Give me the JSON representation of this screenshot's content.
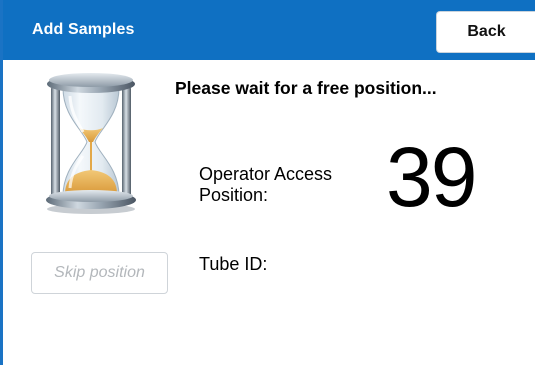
{
  "header": {
    "title": "Add Samples",
    "back_label": "Back",
    "background_color": "#0f70c2"
  },
  "main": {
    "wait_message": "Please wait for a free position...",
    "position_label_line1": "Operator Access",
    "position_label_line2": "Position:",
    "position_number": "39",
    "tube_id_label": "Tube ID:",
    "skip_label": "Skip position",
    "status_icon": "hourglass-icon"
  }
}
